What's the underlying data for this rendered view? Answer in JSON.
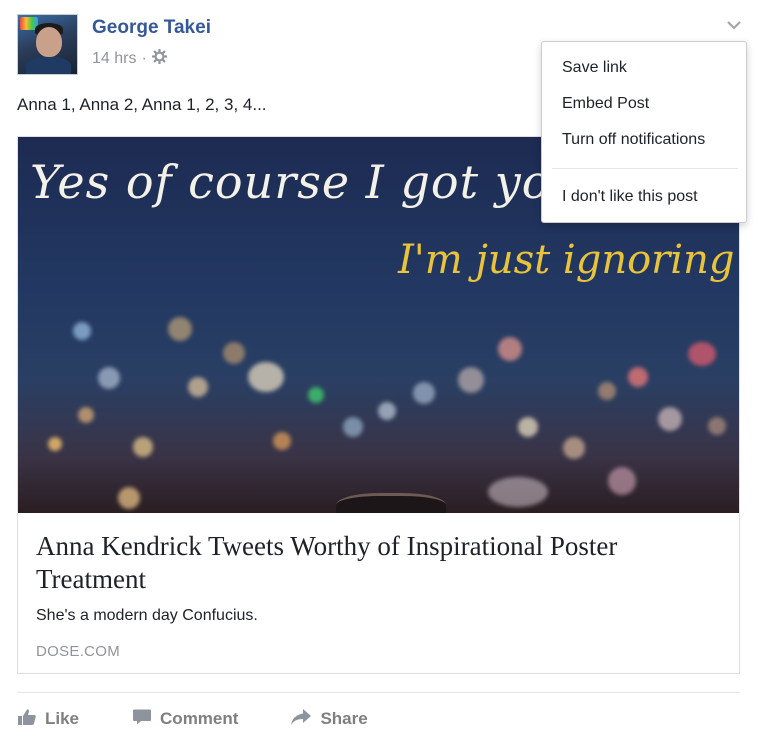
{
  "post": {
    "author": "George Takei",
    "time": "14 hrs",
    "separator": "·",
    "privacy_icon": "gear-icon",
    "text": "Anna 1, Anna 2, Anna 1, 2, 3, 4..."
  },
  "link_card": {
    "image_text_line1": "Yes of course I got your te",
    "image_text_line2": "I'm just ignoring it.",
    "title": "Anna Kendrick Tweets Worthy of Inspirational Poster Treatment",
    "description": "She's a modern day Confucius.",
    "domain": "DOSE.COM"
  },
  "actions": {
    "like": "Like",
    "comment": "Comment",
    "share": "Share"
  },
  "menu": {
    "items": [
      "Save link",
      "Embed Post",
      "Turn off notifications",
      "I don't like this post"
    ]
  },
  "colors": {
    "author_link": "#365899",
    "meta_gray": "#90949c",
    "action_gray": "#7f7f7f",
    "text": "#1d2129"
  }
}
